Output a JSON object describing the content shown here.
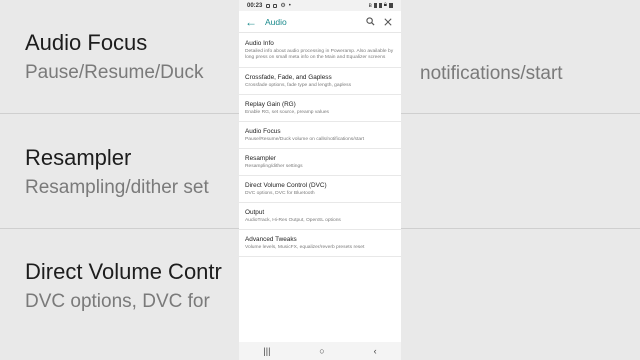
{
  "status_bar": {
    "time": "00:23"
  },
  "app_bar": {
    "title": "Audio"
  },
  "items": [
    {
      "title": "Audio Info",
      "subtitle": "Detailed info about audio processing in Poweramp. Also available by long press on small meta info on the Main and Equalizer screens"
    },
    {
      "title": "Crossfade, Fade, and Gapless",
      "subtitle": "Crossfade options, fade type and length, gapless"
    },
    {
      "title": "Replay Gain (RG)",
      "subtitle": "Enable RG, set source, preamp values"
    },
    {
      "title": "Audio Focus",
      "subtitle": "Pause/Resume/Duck volume on calls/notifications/start"
    },
    {
      "title": "Resampler",
      "subtitle": "Resampling/dither settings"
    },
    {
      "title": "Direct Volume Control (DVC)",
      "subtitle": "DVC options, DVC for Bluetooth"
    },
    {
      "title": "Output",
      "subtitle": "AudioTrack, Hi-Res Output, OpenSL options"
    },
    {
      "title": "Advanced Tweaks",
      "subtitle": "Volume levels, MusicFX, equalizer/reverb presets reset"
    }
  ],
  "background": {
    "items": [
      {
        "title": "Audio Focus",
        "subtitle": "Pause/Resume/Duck",
        "subtitle_right": "notifications/start"
      },
      {
        "title": "Resampler",
        "subtitle": "Resampling/dither set"
      },
      {
        "title": "Direct Volume Contr",
        "subtitle": "DVC options, DVC for"
      }
    ]
  },
  "navbar": {
    "recents": "|||",
    "home": "○",
    "back": "‹"
  },
  "colors": {
    "accent": "#1a8a8c"
  }
}
